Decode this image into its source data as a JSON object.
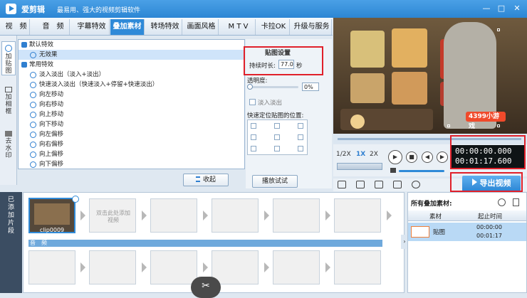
{
  "app": {
    "name": "爱剪辑",
    "slogan": "最易用、强大的视频剪辑软件"
  },
  "window": {
    "minimize": "—",
    "maximize": "□",
    "close": "✕"
  },
  "tabs": [
    {
      "label": "视　频"
    },
    {
      "label": "音　频"
    },
    {
      "label": "字幕特效"
    },
    {
      "label": "叠加素材",
      "active": true
    },
    {
      "label": "转场特效"
    },
    {
      "label": "画面风格"
    },
    {
      "label": "M T V"
    },
    {
      "label": "卡拉OK"
    },
    {
      "label": "升级与服务"
    }
  ],
  "side_tabs": [
    {
      "label": "加贴图"
    },
    {
      "label": "加相框"
    },
    {
      "label": "去水印"
    }
  ],
  "effects": {
    "categories": [
      {
        "label": "默认特效"
      },
      {
        "label": "常用特效"
      }
    ],
    "default_item": "无效果",
    "items": [
      "淡入淡出（淡入+淡出）",
      "快速淡入淡出（快速淡入+停留+快速淡出）",
      "向左移动",
      "向右移动",
      "向上移动",
      "向下移动",
      "向左偏移",
      "向右偏移",
      "向上偏移",
      "向下偏移"
    ],
    "collapse_button": "收起"
  },
  "settings": {
    "title": "贴图设置",
    "duration_label": "持续时长:",
    "duration_value": "77.0",
    "duration_unit": "秒",
    "opacity_label": "透明度:",
    "opacity_value": "0%",
    "fade_label": "淡入淡出",
    "position_label": "快速定位贴图的位置:",
    "preview_button": "播放试试"
  },
  "preview": {
    "logo_text": "4399小游戏",
    "speeds": [
      "1/2X",
      "1X",
      "2X"
    ]
  },
  "time": {
    "current": "00:00:00.000",
    "total": "00:01:17.600"
  },
  "export_button": "导出视频",
  "timeline": {
    "side_label": "已添加片段",
    "clip_name": "clip0009",
    "placeholder": "双击此处添加视频",
    "audio_label": "音　频"
  },
  "added_panel": {
    "title": "所有叠加素材:",
    "columns": [
      "素材",
      "起止时间"
    ],
    "rows": [
      {
        "name": "贴图",
        "start": "00:00:00",
        "end": "00:01:17"
      }
    ]
  },
  "colors": {
    "accent": "#2f8ad8",
    "highlight": "#e0202a"
  }
}
